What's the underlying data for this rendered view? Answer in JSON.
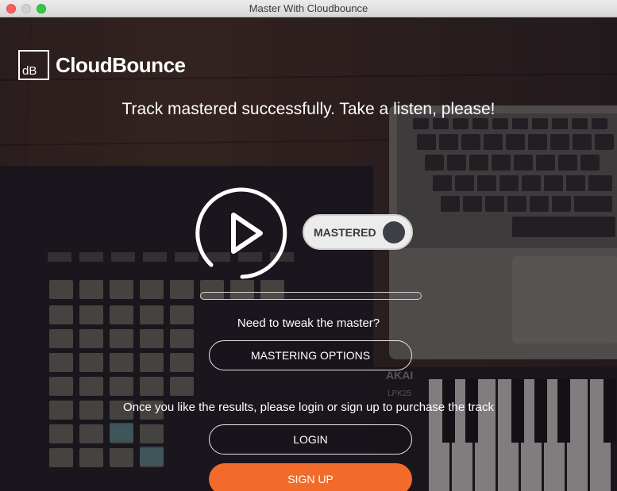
{
  "window": {
    "title": "Master With Cloudbounce"
  },
  "logo": {
    "box_text": "dB",
    "name": "CloudBounce"
  },
  "headline": "Track mastered successfully. Take a listen, please!",
  "player": {
    "toggle_label": "MASTERED",
    "progress": 0.0
  },
  "tweak": {
    "prompt": "Need to tweak the master?",
    "options_label": "MASTERING OPTIONS"
  },
  "purchase": {
    "prompt": "Once you like the results, please login or sign up to purchase the track",
    "login_label": "LOGIN",
    "signup_label": "SIGN UP"
  },
  "colors": {
    "accent": "#f26b2a",
    "knob": "#3e4046"
  },
  "background": {
    "keyboard_brand": "AKAI",
    "keyboard_model": "LPK25"
  }
}
